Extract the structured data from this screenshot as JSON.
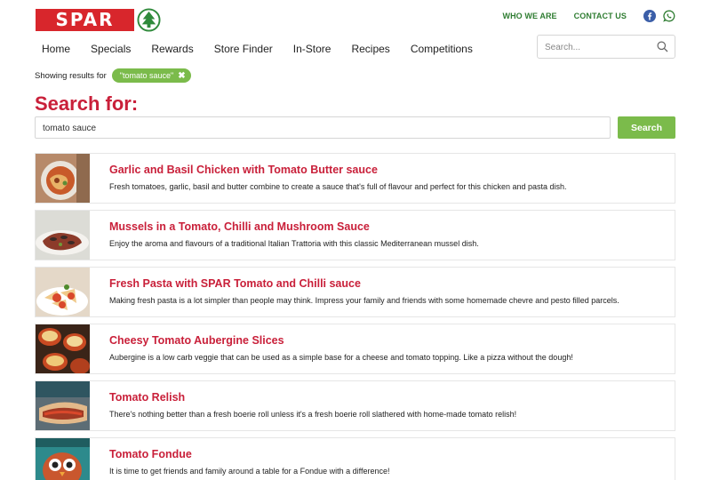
{
  "header": {
    "logo_text": "SPAR",
    "top_links": [
      "WHO WE ARE",
      "CONTACT US"
    ],
    "social": [
      "facebook-icon",
      "whatsapp-icon"
    ]
  },
  "nav": {
    "items": [
      "Home",
      "Specials",
      "Rewards",
      "Store Finder",
      "In-Store",
      "Recipes",
      "Competitions"
    ]
  },
  "site_search": {
    "placeholder": "Search..."
  },
  "filter": {
    "label": "Showing results for",
    "chip": "\"tomato sauce\"",
    "chip_close": "✖"
  },
  "search": {
    "heading": "Search for:",
    "query": "tomato sauce",
    "button": "Search"
  },
  "results": [
    {
      "title": "Garlic and Basil Chicken with Tomato Butter sauce",
      "desc": "Fresh tomatoes, garlic, basil and butter combine to create a sauce that's full of flavour and perfect for this chicken and pasta dish."
    },
    {
      "title": "Mussels in a Tomato, Chilli and Mushroom Sauce",
      "desc": "Enjoy the aroma and flavours of a traditional Italian Trattoria with this classic Mediterranean mussel dish."
    },
    {
      "title": "Fresh Pasta with SPAR Tomato and Chilli sauce",
      "desc": "Making fresh pasta is a lot simpler than people may think. Impress your family and friends with some homemade chevre and pesto filled parcels."
    },
    {
      "title": "Cheesy Tomato Aubergine Slices",
      "desc": "Aubergine is a low carb veggie that can be used as a simple base for a cheese and tomato topping. Like a pizza without the dough!"
    },
    {
      "title": "Tomato Relish",
      "desc": "There's nothing better than a fresh boerie roll unless it's a fresh boerie roll slathered with home-made tomato relish!"
    },
    {
      "title": "Tomato Fondue",
      "desc": "It is time to get friends and family around a table for a Fondue with a difference!"
    }
  ],
  "colors": {
    "brand_red": "#d8262c",
    "title_red": "#c9203a",
    "accent_green": "#7bbb4b",
    "link_green": "#2f7d32"
  }
}
